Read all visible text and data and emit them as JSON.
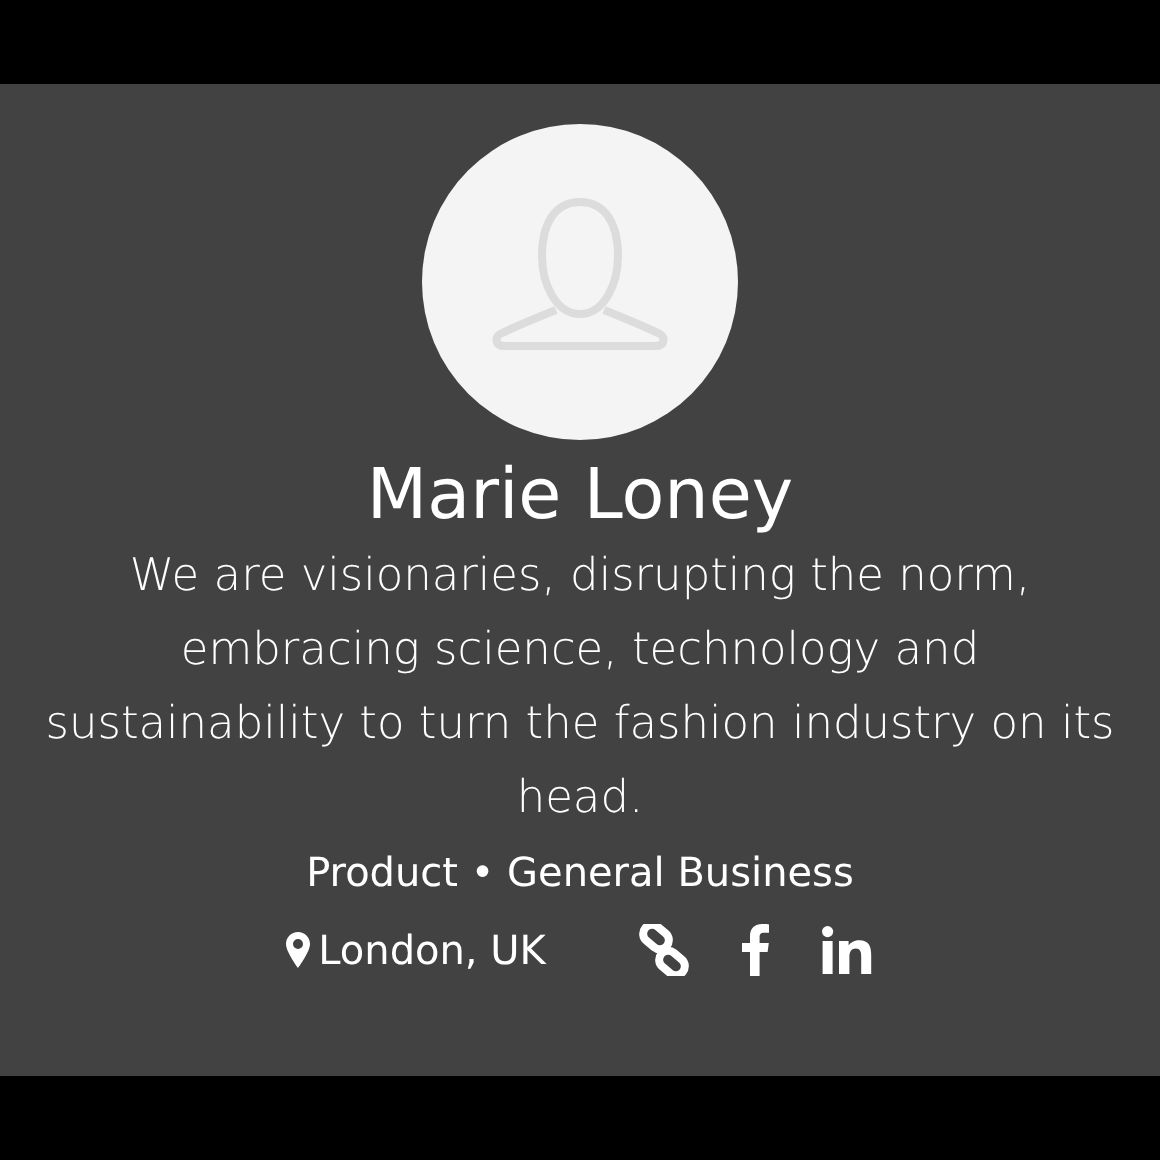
{
  "profile": {
    "name": "Marie Loney",
    "bio": "We are visionaries, disrupting the norm, embracing science, technology and sustainability to turn the fashion industry on its head.",
    "tags": "Product • General Business",
    "location": "London, UK",
    "links": [
      {
        "kind": "website"
      },
      {
        "kind": "facebook"
      },
      {
        "kind": "linkedin"
      }
    ]
  }
}
